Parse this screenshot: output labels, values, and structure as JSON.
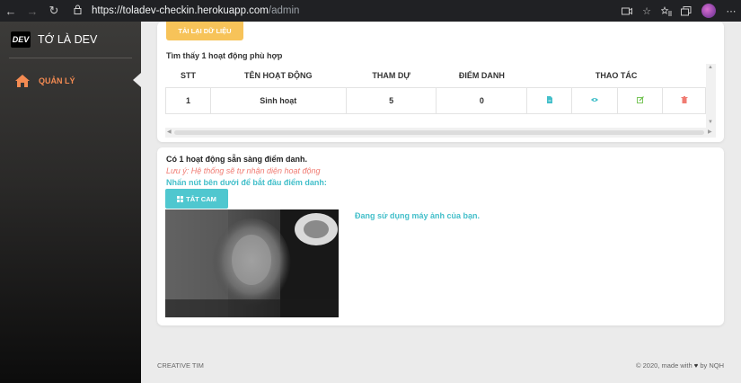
{
  "browser": {
    "url_main": "https://toladev-checkin.herokuapp.com",
    "url_path": "/admin"
  },
  "sidebar": {
    "logo_text": "DEV",
    "brand_name": "TỚ LÀ DEV",
    "items": [
      {
        "label": "QUẢN LÝ",
        "icon": "home-icon",
        "color": "#f48b52"
      }
    ]
  },
  "activities": {
    "reload_label": "TẢI LẠI DỮ LIỆU",
    "found_text": "Tìm thấy 1 hoạt động phù hợp",
    "columns": [
      "STT",
      "TÊN HOẠT ĐỘNG",
      "THAM DỰ",
      "ĐIỂM DANH",
      "THAO TÁC"
    ],
    "rows": [
      {
        "stt": "1",
        "name": "Sinh hoạt",
        "attend": "5",
        "checkin": "0"
      }
    ],
    "actions": [
      "file-icon",
      "eye-icon",
      "edit-icon",
      "trash-icon"
    ],
    "action_colors": [
      "#43bfca",
      "#43bfca",
      "#6cc04a",
      "#f07b72"
    ]
  },
  "camera": {
    "ready_text": "Có 1 hoạt động sẵn sàng điểm danh.",
    "note_text": "Lưu ý: Hệ thống sẽ tự nhận diện hoạt động",
    "instruction_text": "Nhấn nút bên dưới để bắt đầu điểm danh:",
    "button_label": "TẮT CAM",
    "status_text": "Đang sử dụng máy ảnh của bạn."
  },
  "footer": {
    "left": "CREATIVE TIM",
    "right_prefix": "© 2020, made with",
    "right_suffix": "by NQH"
  },
  "colors": {
    "accent_orange": "#f48b52",
    "reload_yellow": "#f7c359",
    "teal": "#43bfca",
    "note_red": "#f07b72"
  }
}
